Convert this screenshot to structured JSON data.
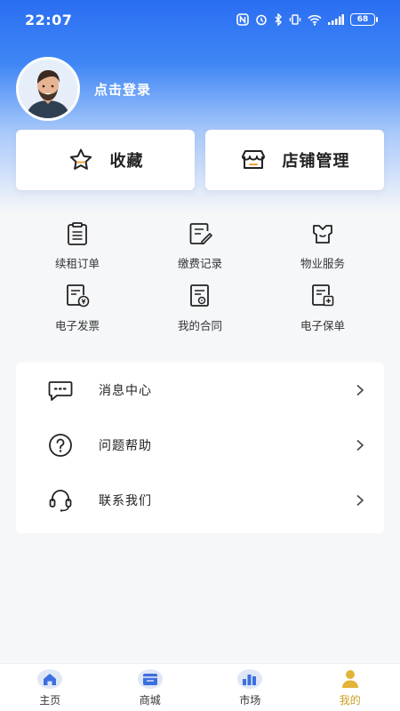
{
  "status_bar": {
    "time": "22:07",
    "battery": "68",
    "icons": [
      "nfc-icon",
      "alarm-icon",
      "bluetooth-icon",
      "vibrate-icon",
      "wifi-icon",
      "signal-icon"
    ]
  },
  "profile": {
    "login_label": "点击登录"
  },
  "quick_cards": [
    {
      "label": "收藏",
      "icon": "star-icon"
    },
    {
      "label": "店铺管理",
      "icon": "shop-icon"
    }
  ],
  "services": [
    {
      "label": "续租订单",
      "icon": "clipboard-icon"
    },
    {
      "label": "缴费记录",
      "icon": "edit-doc-icon"
    },
    {
      "label": "物业服务",
      "icon": "property-icon"
    },
    {
      "label": "电子发票",
      "icon": "invoice-icon"
    },
    {
      "label": "我的合同",
      "icon": "contract-icon"
    },
    {
      "label": "电子保单",
      "icon": "policy-icon"
    }
  ],
  "menu": [
    {
      "label": "消息中心",
      "icon": "message-icon"
    },
    {
      "label": "问题帮助",
      "icon": "help-icon"
    },
    {
      "label": "联系我们",
      "icon": "headset-icon"
    }
  ],
  "tabbar": [
    {
      "label": "主页",
      "icon": "home-icon"
    },
    {
      "label": "商城",
      "icon": "store-icon"
    },
    {
      "label": "市场",
      "icon": "market-icon"
    },
    {
      "label": "我的",
      "icon": "user-icon",
      "active": true
    }
  ],
  "colors": {
    "brand_blue": "#2a6ef2",
    "active_tab": "#caa024",
    "tab_icon_blue": "#3b6fe0"
  }
}
